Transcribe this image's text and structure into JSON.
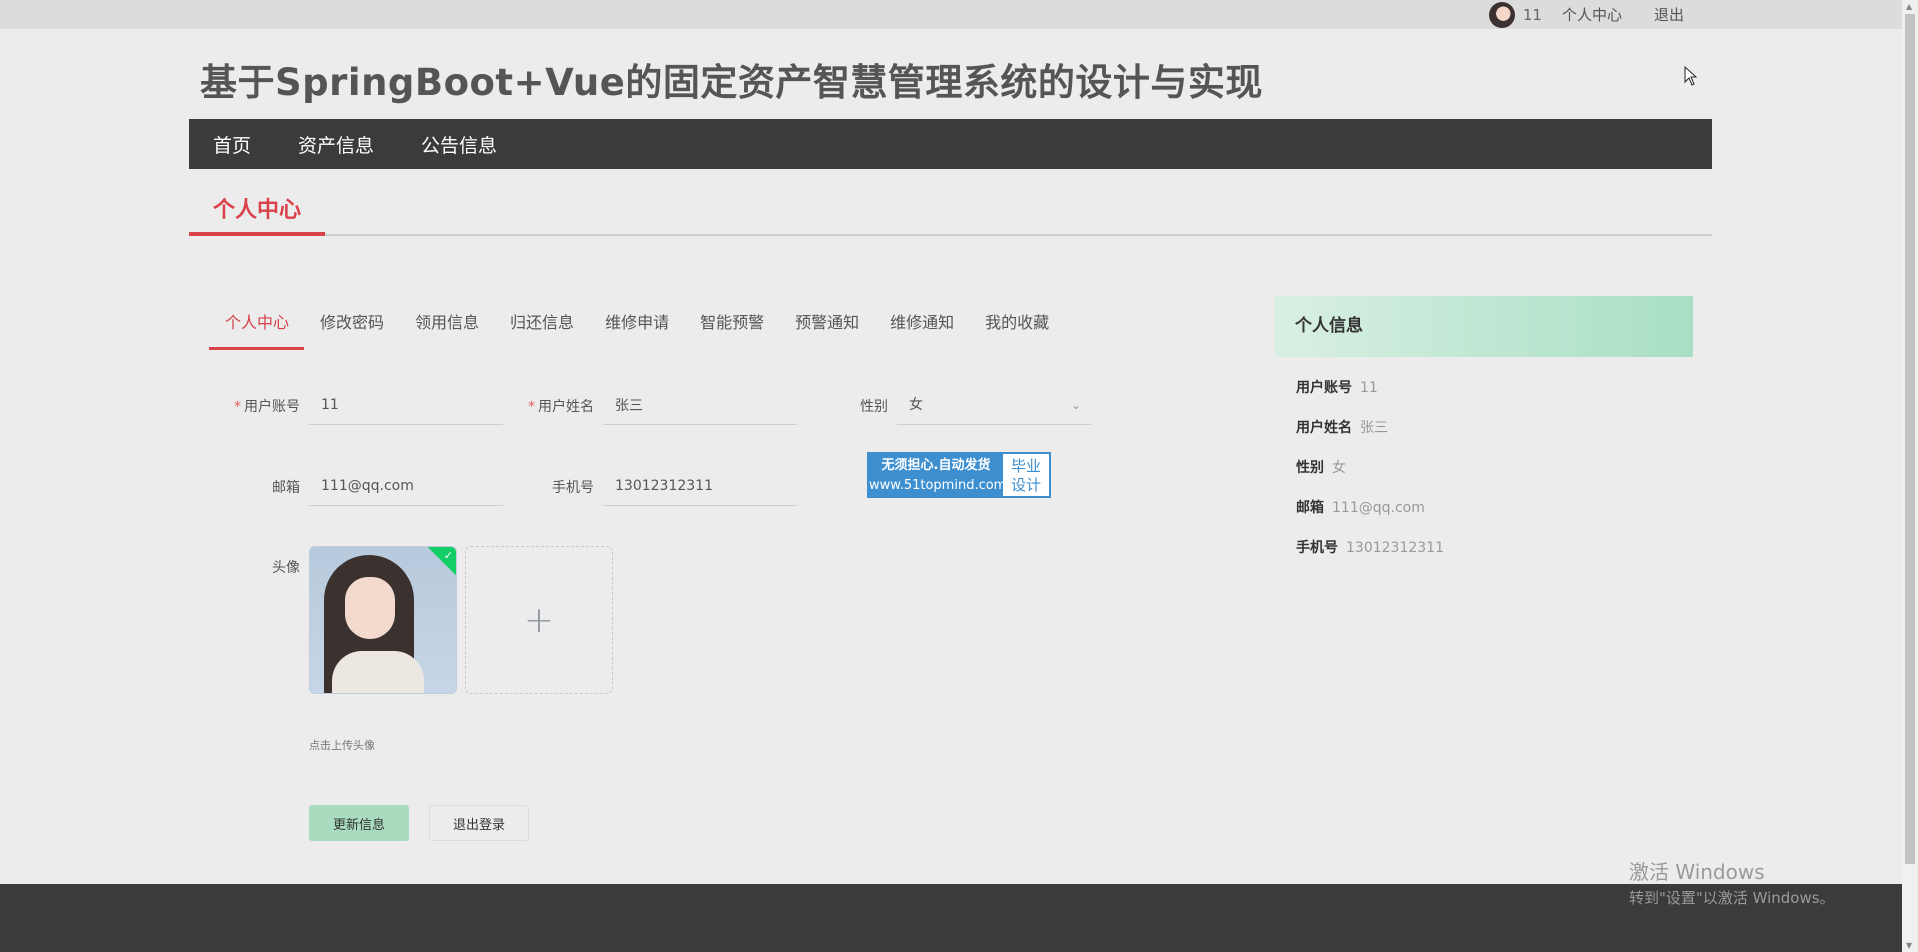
{
  "topbar": {
    "username": "11",
    "profile_link": "个人中心",
    "logout_link": "退出"
  },
  "site_title": "基于SpringBoot+Vue的固定资产智慧管理系统的设计与实现",
  "nav": [
    "首页",
    "资产信息",
    "公告信息"
  ],
  "section_title": "个人中心",
  "tabs": [
    "个人中心",
    "修改密码",
    "领用信息",
    "归还信息",
    "维修申请",
    "智能预警",
    "预警通知",
    "维修通知",
    "我的收藏"
  ],
  "active_tab": "个人中心",
  "form": {
    "account_label": "用户账号",
    "account_value": "11",
    "name_label": "用户姓名",
    "name_value": "张三",
    "gender_label": "性别",
    "gender_value": "女",
    "email_label": "邮箱",
    "email_value": "111@qq.com",
    "phone_label": "手机号",
    "phone_value": "13012312311",
    "avatar_label": "头像",
    "upload_plus": "+",
    "upload_tip": "点击上传头像",
    "update_button": "更新信息",
    "logout_button": "退出登录",
    "required_mark": "*"
  },
  "ad": {
    "line1": "无须担心.自动发货",
    "line2": "www.51topmind.com",
    "right1": "毕业",
    "right2": "设计"
  },
  "info_panel": {
    "title": "个人信息",
    "rows": [
      {
        "k": "用户账号",
        "v": "11"
      },
      {
        "k": "用户姓名",
        "v": "张三"
      },
      {
        "k": "性别",
        "v": "女"
      },
      {
        "k": "邮箱",
        "v": "111@qq.com"
      },
      {
        "k": "手机号",
        "v": "13012312311"
      }
    ]
  },
  "watermark": {
    "line1": "激活 Windows",
    "line2": "转到\"设置\"以激活 Windows。"
  },
  "colors": {
    "accent": "#d9414b",
    "nav_bg": "#3b3b3b",
    "update_btn": "#a9dcbf",
    "info_head_end": "#a8dfc4"
  }
}
